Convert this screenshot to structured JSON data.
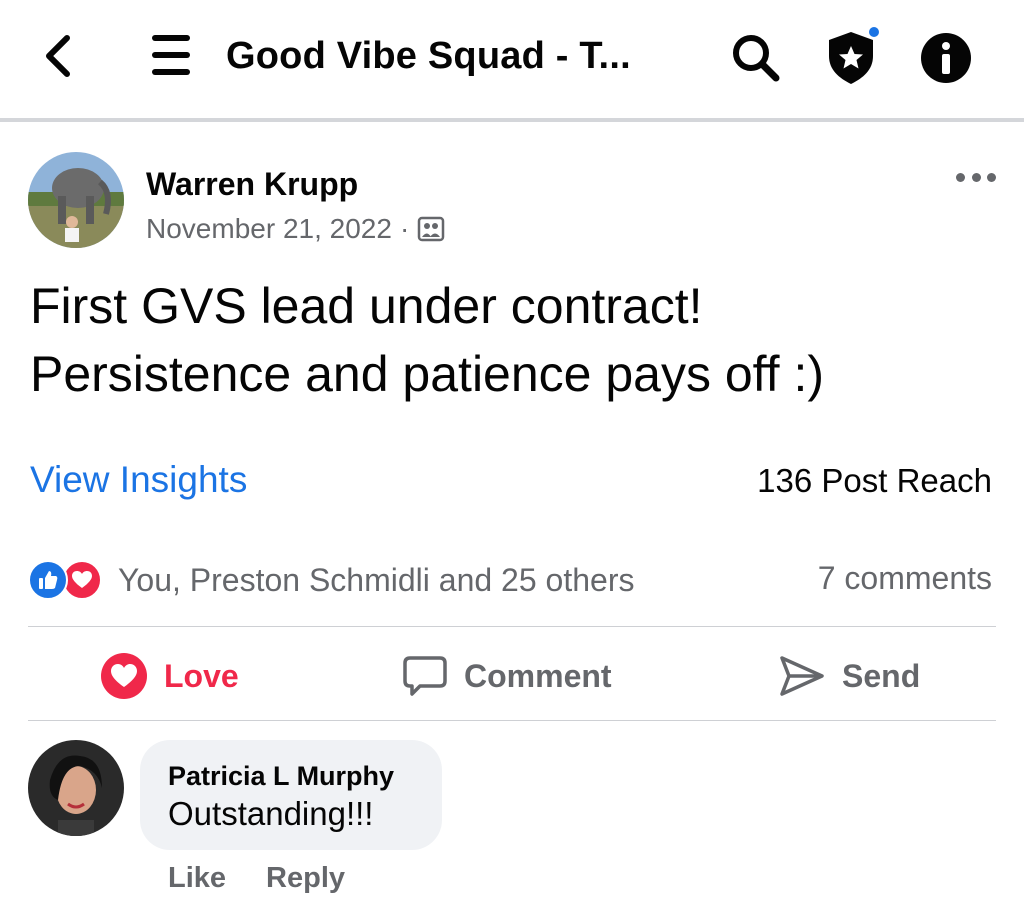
{
  "header": {
    "title": "Good Vibe Squad - T...",
    "back_icon": "chevron-left-icon",
    "menu_icon": "hamburger-menu-icon",
    "search_icon": "search-icon",
    "admin_icon": "shield-star-icon",
    "info_icon": "info-icon",
    "notification_dot_color": "#1b74e4"
  },
  "post": {
    "author": "Warren Krupp",
    "date": "November 21, 2022",
    "separator": "·",
    "audience_icon": "group-audience-icon",
    "text_lines": [
      "First GVS lead under contract!",
      "Persistence and patience pays off :)"
    ],
    "insights_label": "View Insights",
    "reach": "136 Post Reach",
    "reactors": "You, Preston Schmidli and 25 others",
    "comments_count": "7 comments",
    "reaction_icons": [
      "like-reaction-icon",
      "love-reaction-icon"
    ]
  },
  "actions": {
    "love": "Love",
    "comment": "Comment",
    "send": "Send"
  },
  "comment": {
    "author": "Patricia L Murphy",
    "text": "Outstanding!!!",
    "like": "Like",
    "reply": "Reply"
  },
  "colors": {
    "accent": "#1b74e4",
    "love": "#f0284a",
    "muted": "#65676b",
    "bubble": "#f0f2f5"
  }
}
